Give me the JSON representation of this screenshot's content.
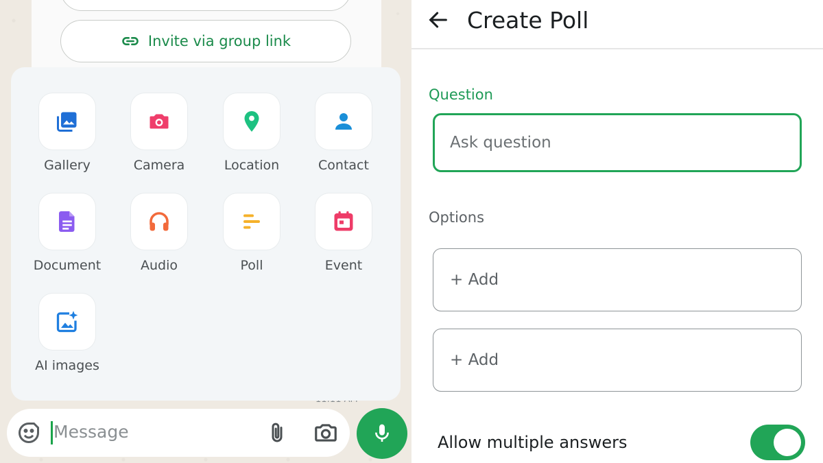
{
  "chat": {
    "invite_label": "Invite via group link",
    "timestamp": "11:11 AM",
    "message_placeholder": "Message"
  },
  "attach_menu": {
    "items": [
      {
        "label": "Gallery",
        "icon": "gallery-icon",
        "color": "#1f6fd6"
      },
      {
        "label": "Camera",
        "icon": "camera-icon",
        "color": "#ef3e6b"
      },
      {
        "label": "Location",
        "icon": "location-pin-icon",
        "color": "#1dc181"
      },
      {
        "label": "Contact",
        "icon": "contact-icon",
        "color": "#1a8fd8"
      },
      {
        "label": "Document",
        "icon": "document-icon",
        "color": "#8b5cf0"
      },
      {
        "label": "Audio",
        "icon": "headphones-icon",
        "color": "#f26a3b"
      },
      {
        "label": "Poll",
        "icon": "poll-icon",
        "color": "#f5b12a"
      },
      {
        "label": "Event",
        "icon": "calendar-icon",
        "color": "#ee3c68"
      },
      {
        "label": "AI images",
        "icon": "ai-image-icon",
        "color": "#1f7fe0"
      }
    ]
  },
  "poll": {
    "title": "Create Poll",
    "question_label": "Question",
    "question_placeholder": "Ask question",
    "options_label": "Options",
    "option_placeholder_1": "+ Add",
    "option_placeholder_2": "+ Add",
    "allow_multiple_label": "Allow multiple answers",
    "allow_multiple": true
  },
  "colors": {
    "accent": "#21a557",
    "accent_text": "#1e9a56"
  }
}
